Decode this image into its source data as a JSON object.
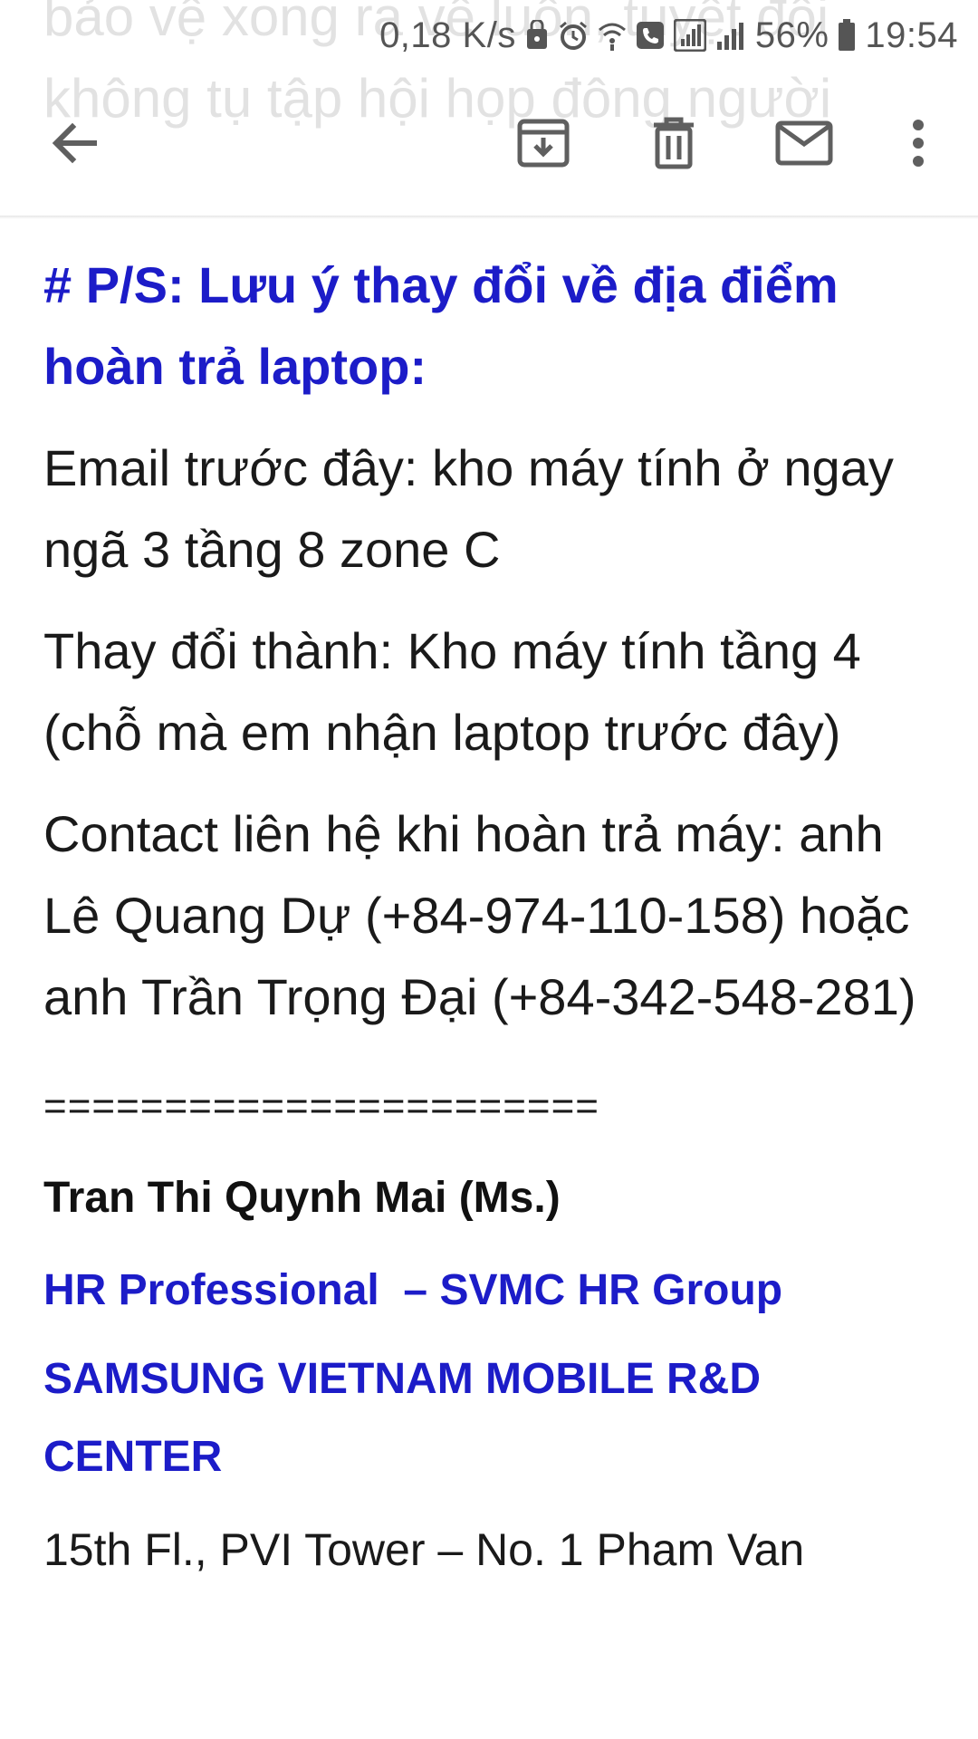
{
  "ghost_text": {
    "line1": "bảo vệ xong ra về luôn, tuyệt đối",
    "line2": "không tụ tập hội họp đông người"
  },
  "status_bar": {
    "network_speed": "0,18 K/s",
    "battery_percent": "56%",
    "time": "19:54"
  },
  "toolbar": {
    "back_icon": "arrow-left",
    "archive_icon": "archive-box",
    "delete_icon": "trash-can",
    "mark_unread_icon": "envelope",
    "more_icon": "vertical-dots"
  },
  "email": {
    "ps_heading": "# P/S: Lưu ý thay đổi về địa điểm hoàn trả laptop:",
    "previous_location": "Email trước đây: kho máy tính ở ngay ngã 3 tầng 8 zone C",
    "new_location": "Thay đổi thành: Kho máy tính tầng 4 (chỗ mà em nhận laptop trước đây)",
    "contact": "Contact liên hệ khi hoàn trả máy: anh Lê Quang Dự (+84-974-110-158) hoặc anh Trần Trọng Đại (+84-342-548-281)",
    "separator": "=======================",
    "signature": {
      "name": "Tran Thi Quynh Mai (Ms.)",
      "title": "HR Professional  – SVMC HR Group",
      "company": "SAMSUNG VIETNAM MOBILE R&D CENTER",
      "address_partial": "15th Fl., PVI Tower – No. 1 Pham Van"
    }
  },
  "colors": {
    "heading_blue": "#1c1cc8",
    "icon_gray": "#5f5f5f",
    "text": "#1a1a1a"
  }
}
